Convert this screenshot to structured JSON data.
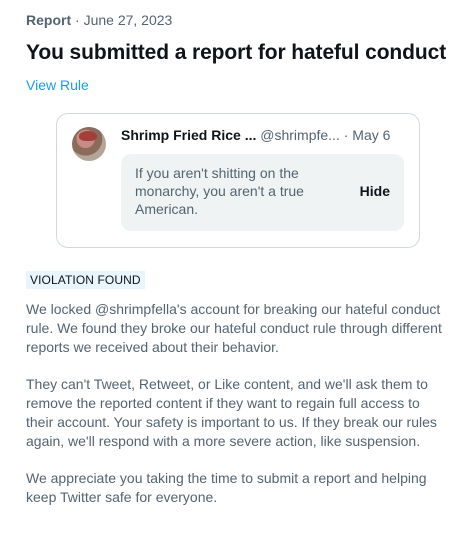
{
  "report": {
    "type_label": "Report",
    "separator": " · ",
    "date": "June 27, 2023",
    "title": "You submitted a report for hateful conduct",
    "view_rule_label": "View Rule"
  },
  "tweet": {
    "author_name": "Shrimp Fried Rice ...",
    "handle": "@shrimpfe...",
    "separator": " · ",
    "date": "May 6",
    "hidden_text": "If you aren't shitting on the monarchy, you aren't a true American.",
    "hide_label": "Hide"
  },
  "status_badge": "VIOLATION FOUND",
  "paragraphs": [
    "We locked @shrimpfella's account for breaking our hateful conduct rule. We found they broke our hateful conduct rule through different reports we received about their behavior.",
    "They can't Tweet, Retweet, or Like content, and we'll ask them to remove the reported content if they want to regain full access to their account. Your safety is important to us. If they break our rules again, we'll respond with a more severe action, like suspension.",
    "We appreciate you taking the time to submit a report and helping keep Twitter safe for everyone."
  ]
}
